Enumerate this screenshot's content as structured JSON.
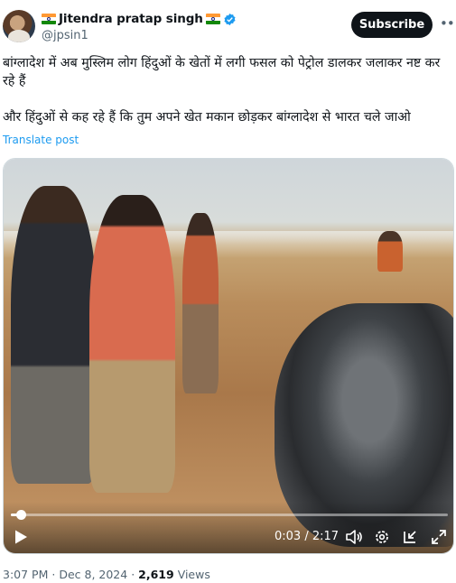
{
  "author": {
    "display_name": "Jitendra pratap singh",
    "handle": "@jpsin1",
    "verified": true,
    "icons": [
      "india-flag-emoji",
      "india-flag-emoji",
      "verified-badge"
    ]
  },
  "header": {
    "subscribe_label": "Subscribe",
    "more_label": "•••"
  },
  "tweet": {
    "paragraphs": [
      "बांग्लादेश में अब मुस्लिम लोग हिंदुओं के खेतों में लगी फसल को पेट्रोल डालकर जलाकर नष्ट कर रहे हैं",
      "और हिंदुओं से कह रहे हैं कि तुम अपने खेत मकान छोड़कर बांग्लादेश से भारत चले जाओ"
    ],
    "translate_label": "Translate post"
  },
  "video": {
    "current_time": "0:03",
    "separator": "/",
    "duration": "2:17",
    "time_display": "0:03 / 2:17",
    "progress_fraction": 0.022,
    "icons": [
      "play-icon",
      "volume-icon",
      "settings-icon",
      "minimize-icon",
      "fullscreen-icon"
    ]
  },
  "meta": {
    "time": "3:07 PM",
    "date": "Dec 8, 2024",
    "views_count": "2,619",
    "views_label": "Views",
    "dot": "·"
  },
  "colors": {
    "text": "#0f1419",
    "secondary": "#536471",
    "link": "#1d9bf0",
    "verified": "#1d9bf0",
    "button_bg": "#0f1419"
  }
}
